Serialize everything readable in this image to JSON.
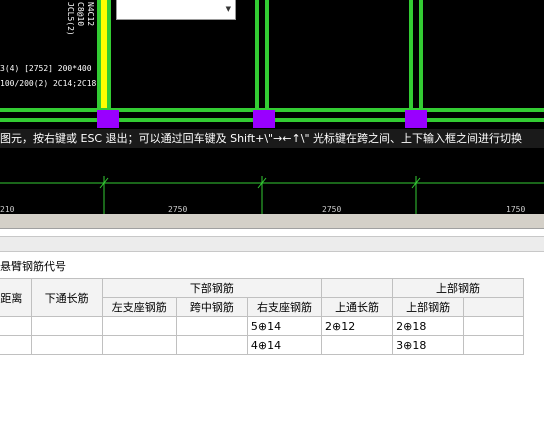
{
  "cad": {
    "vertical_labels": [
      "JCL5(2)",
      "C8@10",
      "N4C12"
    ],
    "beam_label_line1": "3(4) [2752] 200*400",
    "beam_label_line2": "100/200(2) 2C14;2C18",
    "dimension_labels": [
      "210",
      "2750",
      "2750",
      "1750"
    ],
    "prompt": "图元，按右键或 ESC 退出；可以通过回车键及 Shift+\\\"→←↑\\\" 光标键在跨之间、上下输入框之间进行切换"
  },
  "panel": {
    "caption": "悬臂钢筋代号",
    "headers": {
      "col_distance": "线距离",
      "col_bottom_through": "下通长筋",
      "group_bottom": "下部钢筋",
      "col_left_support": "左支座钢筋",
      "col_mid_span": "跨中钢筋",
      "col_right_support": "右支座钢筋",
      "group_top": "上部钢筋",
      "col_top_through": "上通长筋",
      "col_top_bar": "上部钢筋"
    },
    "rows": [
      {
        "distance": "",
        "bottom_through": "",
        "left_support": "",
        "mid_span": "",
        "right_support": "5⊕14",
        "top_through": "2⊕12",
        "top_bar": "2⊕18"
      },
      {
        "distance": "",
        "bottom_through": "",
        "left_support": "",
        "mid_span": "",
        "right_support": "4⊕14",
        "top_through": "",
        "top_bar": "3⊕18"
      }
    ]
  },
  "colors": {
    "beam_green": "#33cc33",
    "column_magenta": "#9900ff",
    "selected_yellow": "#ffff00",
    "cad_background": "#000000"
  }
}
